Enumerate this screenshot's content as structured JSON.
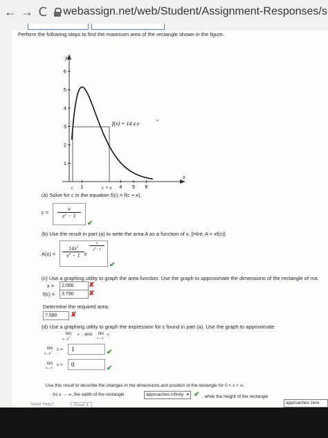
{
  "browser": {
    "back_label": "←",
    "forward_label": "→",
    "reload_label": "C",
    "url": "webassign.net/web/Student/Assignment-Responses/submit?pos=8&c"
  },
  "question": {
    "intro": "Perform the following steps to find the maximum area of the rectangle shown in the figure."
  },
  "graph": {
    "y_axis_label": "y",
    "x_axis_label": "x",
    "y_ticks": [
      "1",
      "2",
      "3",
      "4",
      "5",
      "6"
    ],
    "x_ticks": [
      "1",
      "4",
      "5",
      "6"
    ],
    "c_label": "c",
    "cx_label": "c + x",
    "function_label": "f(x) = 14 x e",
    "function_exponent": "−x",
    "curve_color": "#111111"
  },
  "part_a": {
    "prompt": "(a) Solve for c in the equation f(c) = f(c + x).",
    "lhs": "c =",
    "numerator": "x",
    "denominator": "e",
    "denominator_exp": "x",
    "denominator_tail": "− 1"
  },
  "part_b": {
    "prompt": "(b) Use the result in part (a) to write the area A as a function of x. [Hint: A = xf(c)]",
    "lhs": "A(x) =",
    "numerator": "14x",
    "numerator_exp": "2",
    "denominator": "e",
    "denominator_exp": "x",
    "denominator_tail": "− 1",
    "e_label": "e",
    "exp_num": "x",
    "exp_den": "e",
    "exp_den_exp": "x",
    "exp_den_tail": "− 1"
  },
  "part_c": {
    "prompt": "(c) Use a graphing utility to graph the area function. Use the graph to approximate the dimensions of the rectangle of ma",
    "x_label": "x =",
    "x_value": "2.000",
    "fc_label": "f(c) =",
    "fc_value": "3.790",
    "area_prompt": "Determine the required area.",
    "area_value": "7.580"
  },
  "part_d": {
    "prompt": "(d) Use a graphing utility to graph the expression for c found in part (a). Use the graph to approximate",
    "lim1": "lim",
    "lim1_sub": "x→0",
    "lim1_sup": "+",
    "and_label": "and",
    "lim2": "lim",
    "lim2_sub": "x→∞",
    "var_c": "c",
    "row1_lim": "lim",
    "row1_sub": "x→0",
    "row1_sup": "+",
    "row1_eq": "c =",
    "row1_value": "1",
    "row2_lim": "lim",
    "row2_sub": "x→∞",
    "row2_eq": "c =",
    "row2_value": "0"
  },
  "part_e": {
    "prompt": "Use this result to describe the changes in the dimensions and position of the rectangle for 0 < x < ∞.",
    "sentence_start": "As x → ∞, the width of the rectangle",
    "width_select": "approaches infinity",
    "sentence_mid": ", while the height of the rectangle",
    "height_select": "approaches zero"
  },
  "footer": {
    "need_help": "Need Help?",
    "read_it": "Read It"
  }
}
